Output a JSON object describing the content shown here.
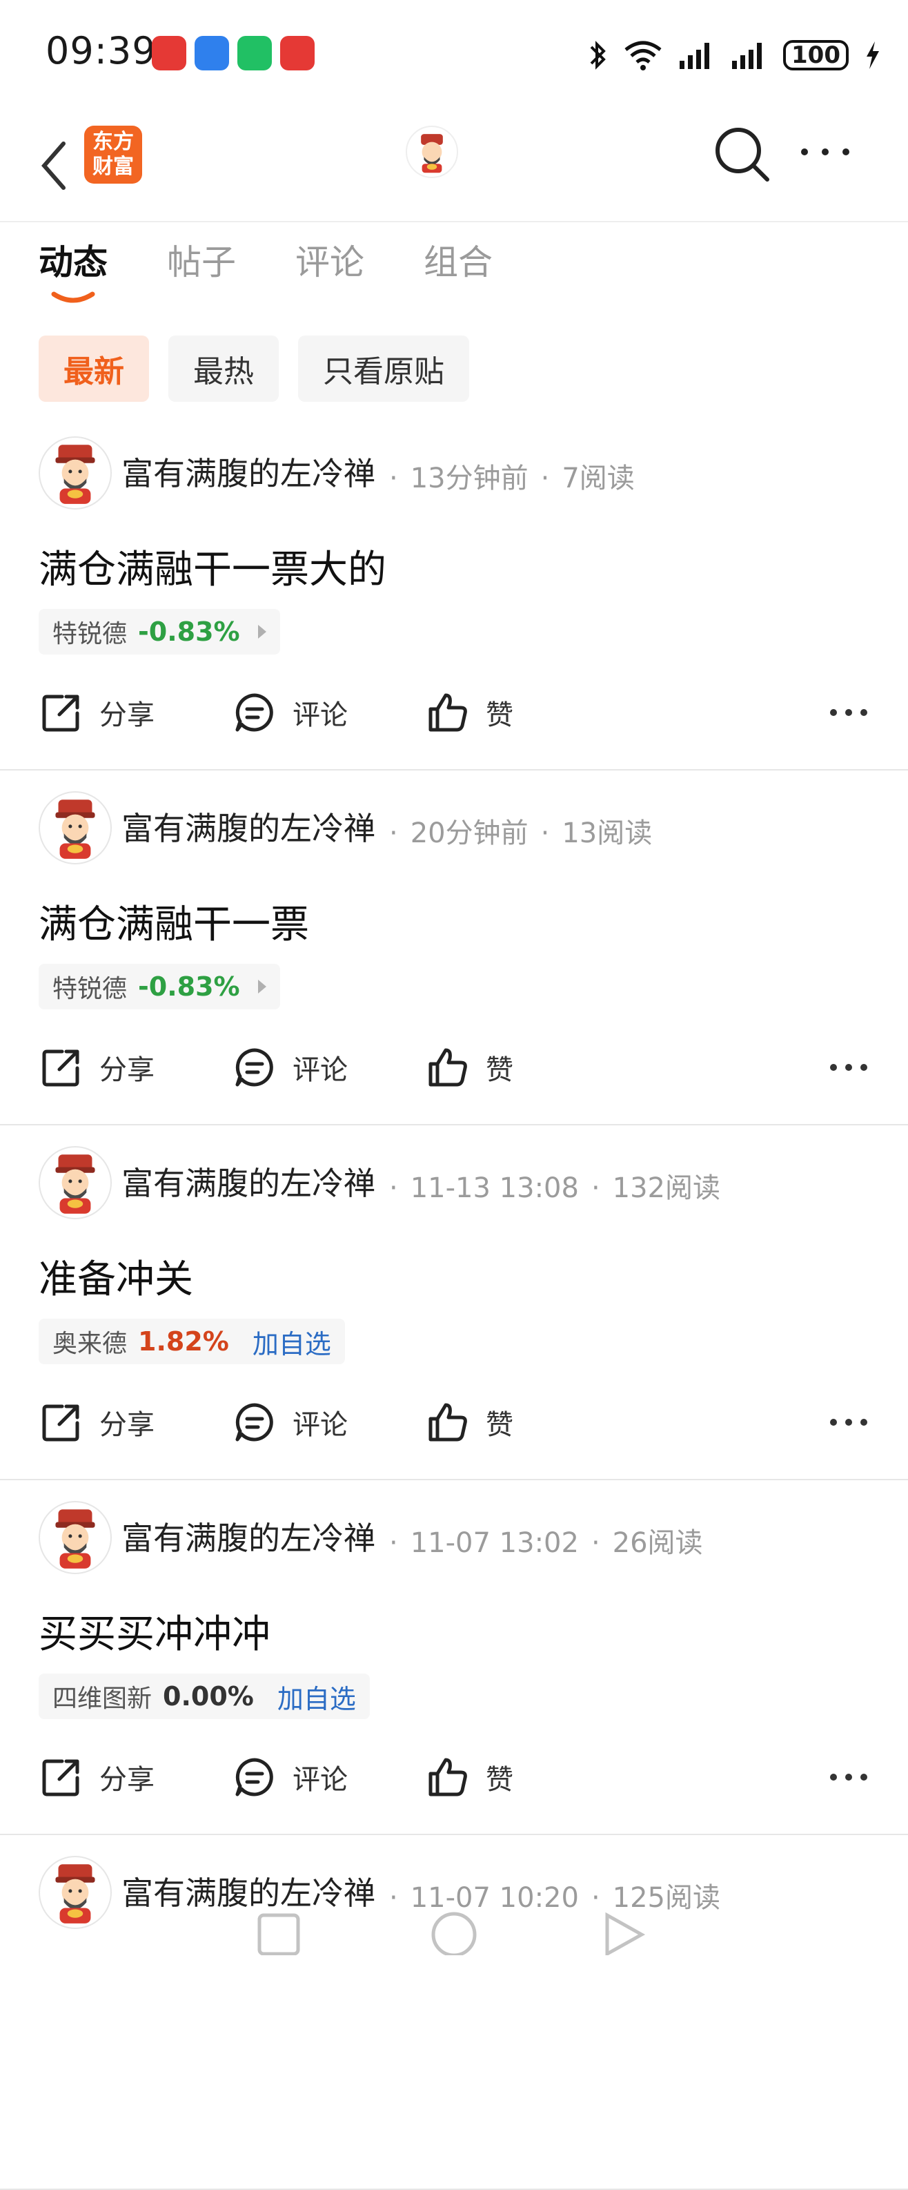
{
  "status_bar": {
    "time": "09:39",
    "app_icons": [
      {
        "name": "broker-app-icon",
        "color": "#e53935"
      },
      {
        "name": "message-app-icon",
        "color": "#2f80ed"
      },
      {
        "name": "wechat-pay-app-icon",
        "color": "#21c064"
      },
      {
        "name": "stock-app-icon",
        "color": "#e53935"
      }
    ],
    "battery": "100"
  },
  "header": {
    "logo_text_line1": "东方",
    "logo_text_line2": "财富"
  },
  "tabs": [
    {
      "label": "动态",
      "active": true
    },
    {
      "label": "帖子",
      "active": false
    },
    {
      "label": "评论",
      "active": false
    },
    {
      "label": "组合",
      "active": false
    }
  ],
  "filters": [
    {
      "label": "最新",
      "active": true
    },
    {
      "label": "最热",
      "active": false
    },
    {
      "label": "只看原贴",
      "active": false
    }
  ],
  "actions": {
    "share": "分享",
    "comment": "评论",
    "like": "赞"
  },
  "colors": {
    "accent": "#f0601c",
    "down": "#2ea043",
    "up": "#d4441c",
    "link": "#2b6cc4"
  },
  "posts": [
    {
      "author": "富有满腹的左冷禅",
      "time": "13分钟前",
      "reads": "7阅读",
      "text": "满仓满融干一票大的",
      "stock": {
        "name": "特锐德",
        "change": "-0.83%",
        "trend": "down",
        "extra": ""
      }
    },
    {
      "author": "富有满腹的左冷禅",
      "time": "20分钟前",
      "reads": "13阅读",
      "text": "满仓满融干一票",
      "stock": {
        "name": "特锐德",
        "change": "-0.83%",
        "trend": "down",
        "extra": ""
      }
    },
    {
      "author": "富有满腹的左冷禅",
      "time": "11-13 13:08",
      "reads": "132阅读",
      "text": "准备冲关",
      "stock": {
        "name": "奥来德",
        "change": "1.82%",
        "trend": "up",
        "extra": "加自选"
      }
    },
    {
      "author": "富有满腹的左冷禅",
      "time": "11-07 13:02",
      "reads": "26阅读",
      "text": "买买买冲冲冲",
      "stock": {
        "name": "四维图新",
        "change": "0.00%",
        "trend": "flat",
        "extra": "加自选"
      }
    },
    {
      "author": "富有满腹的左冷禅",
      "time": "11-07 10:20",
      "reads": "125阅读",
      "text": "",
      "stock": null
    }
  ]
}
